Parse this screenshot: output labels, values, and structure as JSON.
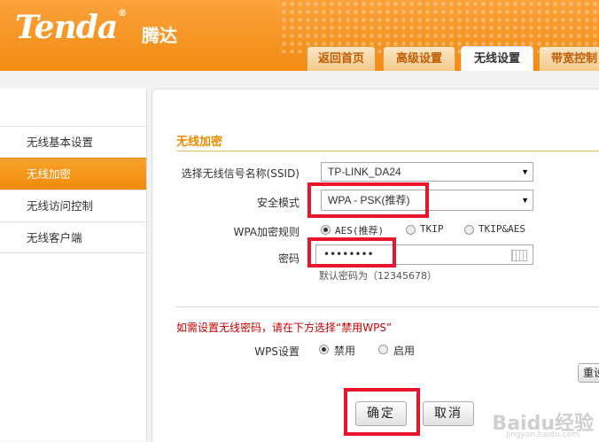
{
  "header": {
    "logo_text": "Tenda",
    "logo_reg": "®",
    "logo_cn": "腾达",
    "tabs": [
      {
        "label": "返回首页"
      },
      {
        "label": "高级设置"
      },
      {
        "label": "无线设置"
      },
      {
        "label": "带宽控制"
      }
    ]
  },
  "sidebar": {
    "items": [
      {
        "label": "无线基本设置"
      },
      {
        "label": "无线加密"
      },
      {
        "label": "无线访问控制"
      },
      {
        "label": "无线客户端"
      }
    ]
  },
  "main": {
    "section_title": "无线加密",
    "ssid": {
      "label": "选择无线信号名称(SSID)",
      "value": "TP-LINK_DA24"
    },
    "security": {
      "label": "安全模式",
      "value": "WPA - PSK(推荐)"
    },
    "wpa_rule": {
      "label": "WPA加密规则",
      "options": [
        {
          "label": "AES(推荐)"
        },
        {
          "label": "TKIP"
        },
        {
          "label": "TKIP&AES"
        }
      ]
    },
    "password": {
      "label": "密码",
      "value": "••••••••",
      "hint": "默认密码为（12345678）"
    },
    "warning": "如需设置无线密码，请在下方选择“禁用WPS”",
    "wps": {
      "label": "WPS设置",
      "options": [
        {
          "label": "禁用"
        },
        {
          "label": "启用"
        }
      ]
    },
    "reset_partial": "重设",
    "ok_button": "确定",
    "cancel_button": "取消"
  },
  "watermark": {
    "text": "Baidu经验",
    "sub": "jingyan.baidu.com"
  },
  "colors": {
    "accent": "#f28b12",
    "highlight": "#e8152c",
    "warning": "#cc0000"
  }
}
